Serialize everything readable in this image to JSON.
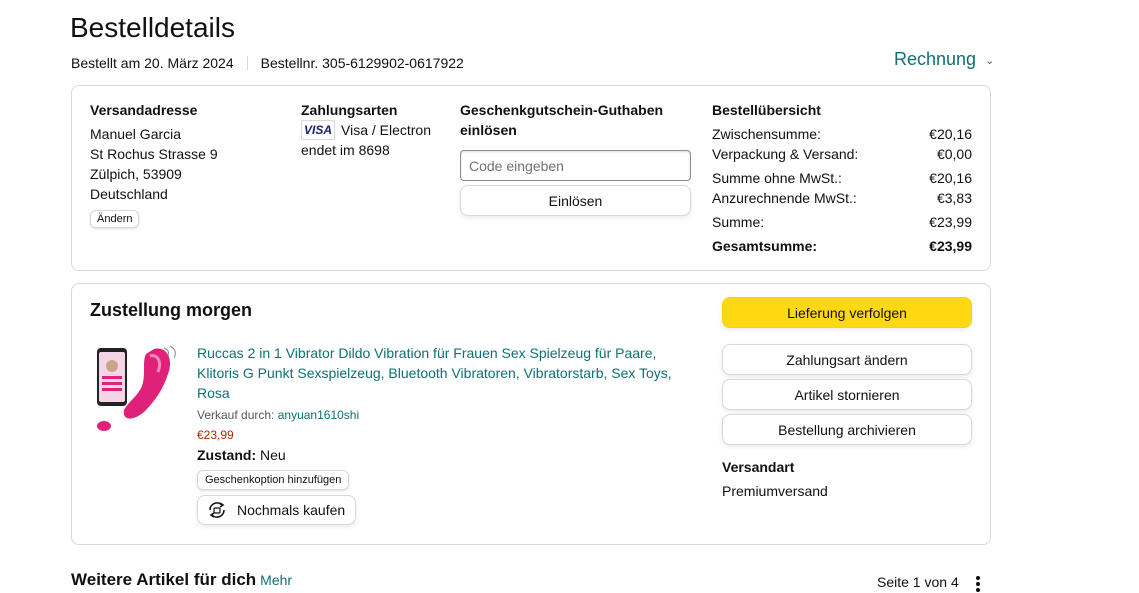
{
  "page": {
    "title": "Bestelldetails",
    "ordered_on": "Bestellt am 20. März 2024",
    "order_number": "Bestellnr. 305-6129902-0617922",
    "invoice_label": "Rechnung",
    "invoice_chevron": "⌄"
  },
  "shipping_address": {
    "heading": "Versandadresse",
    "name": "Manuel Garcia",
    "street": "St Rochus Strasse 9",
    "city": "Zülpich, 53909",
    "country": "Deutschland",
    "change_label": "Ändern"
  },
  "payment": {
    "heading": "Zahlungsarten",
    "card_logo": "VISA",
    "card_type": "Visa / Electron",
    "card_ending": "endet im 8698"
  },
  "gift_card": {
    "heading": "Geschenkgutschein-Guthaben einlösen",
    "input_placeholder": "Code eingeben",
    "redeem_label": "Einlösen"
  },
  "summary": {
    "heading": "Bestellübersicht",
    "rows": [
      {
        "label": "Zwischensumme:",
        "value": "€20,16"
      },
      {
        "label": "Verpackung & Versand:",
        "value": "€0,00"
      },
      {
        "label": "Summe ohne MwSt.:",
        "value": "€20,16"
      },
      {
        "label": "Anzurechnende MwSt.:",
        "value": "€3,83"
      },
      {
        "label": "Summe:",
        "value": "€23,99"
      }
    ],
    "total_label": "Gesamtsumme:",
    "total_value": "€23,99"
  },
  "delivery": {
    "status": "Zustellung morgen",
    "product_title": "Ruccas 2 in 1 Vibrator Dildo Vibration für Frauen Sex Spielzeug für Paare, Klitoris G Punkt Sexspielzeug, Bluetooth Vibratoren, Vibratorstarb, Sex Toys, Rosa",
    "seller_prefix": "Verkauf durch:",
    "seller_name": "anyuan1610shi",
    "price": "€23,99",
    "condition_label": "Zustand:",
    "condition_value": "Neu",
    "gift_option_label": "Geschenkoption hinzufügen",
    "buy_again_label": "Nochmals kaufen",
    "actions": {
      "track": "Lieferung verfolgen",
      "change_payment": "Zahlungsart ändern",
      "cancel": "Artikel stornieren",
      "archive": "Bestellung archivieren"
    },
    "shipping_method_heading": "Versandart",
    "shipping_method": "Premiumversand"
  },
  "more_items": {
    "title": "Weitere Artikel für dich",
    "more_link": "Mehr",
    "page_indicator": "Seite 1 von 4"
  },
  "colors": {
    "link": "#0f6f73",
    "price": "#b12704",
    "primary_button": "#ffd814",
    "product_pink": "#e0217a"
  }
}
